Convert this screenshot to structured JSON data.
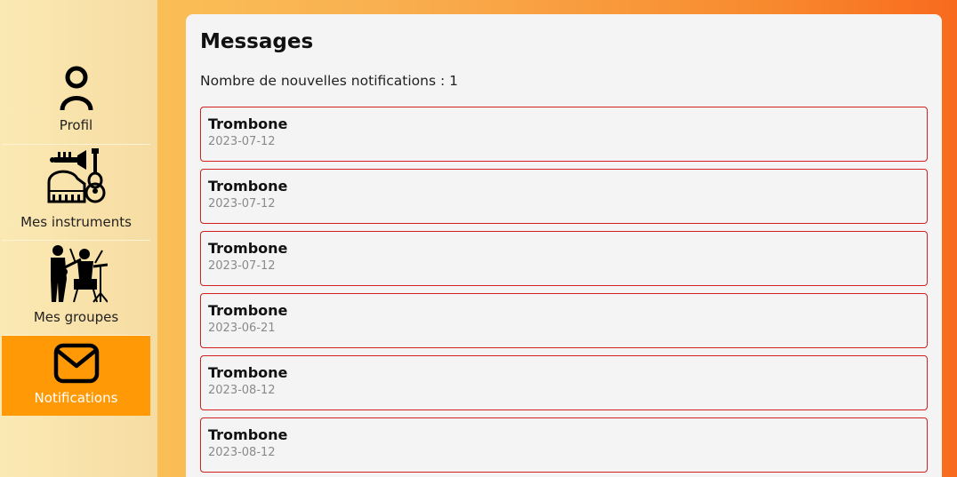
{
  "sidebar": {
    "items": [
      {
        "label": "Profil",
        "icon": "user-icon",
        "active": false
      },
      {
        "label": "Mes instruments",
        "icon": "instruments-icon",
        "active": false
      },
      {
        "label": "Mes groupes",
        "icon": "band-icon",
        "active": false
      },
      {
        "label": "Notifications",
        "icon": "envelope-icon",
        "active": true
      }
    ]
  },
  "main": {
    "title": "Messages",
    "count_line": "Nombre de nouvelles notifications : 1",
    "messages": [
      {
        "title": "Trombone",
        "date": "2023-07-12"
      },
      {
        "title": "Trombone",
        "date": "2023-07-12"
      },
      {
        "title": "Trombone",
        "date": "2023-07-12"
      },
      {
        "title": "Trombone",
        "date": "2023-06-21"
      },
      {
        "title": "Trombone",
        "date": "2023-08-12"
      },
      {
        "title": "Trombone",
        "date": "2023-08-12"
      }
    ]
  },
  "colors": {
    "active_nav": "#ff9a06",
    "message_border": "#d21f1f",
    "panel_bg": "#f4f4f4"
  }
}
